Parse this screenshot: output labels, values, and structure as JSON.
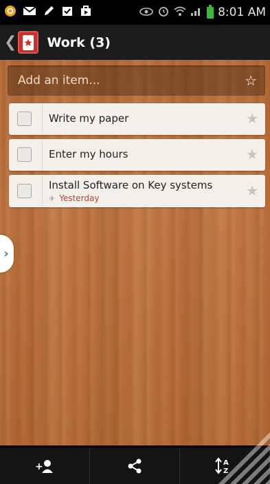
{
  "status_bar": {
    "time": "8:01 AM",
    "left_icons": [
      "notification-icon",
      "mail-icon",
      "pencil-icon",
      "task-icon",
      "bag-icon"
    ],
    "right_icons": [
      "eye-icon",
      "alarm-icon",
      "wifi-icon",
      "signal-icon",
      "battery-icon"
    ]
  },
  "app_bar": {
    "back_glyph": "❮",
    "list_title": "Work (3)"
  },
  "add_item": {
    "placeholder": "Add an item..."
  },
  "tasks": [
    {
      "title": "Write my paper",
      "starred": false,
      "meta": ""
    },
    {
      "title": "Enter my hours",
      "starred": false,
      "meta": ""
    },
    {
      "title": "Install Software on Key systems",
      "starred": false,
      "meta": "Yesterday"
    }
  ],
  "bottom_bar": {
    "buttons": [
      {
        "icon": "add-user-icon",
        "glyph": "+👤"
      },
      {
        "icon": "share-icon",
        "glyph": "<"
      },
      {
        "icon": "sort-az-icon",
        "glyph": "↕AZ"
      }
    ]
  },
  "colors": {
    "accent_red": "#c9302c",
    "due_red": "#c73a30",
    "side_tab_blue": "#2d86c8"
  }
}
